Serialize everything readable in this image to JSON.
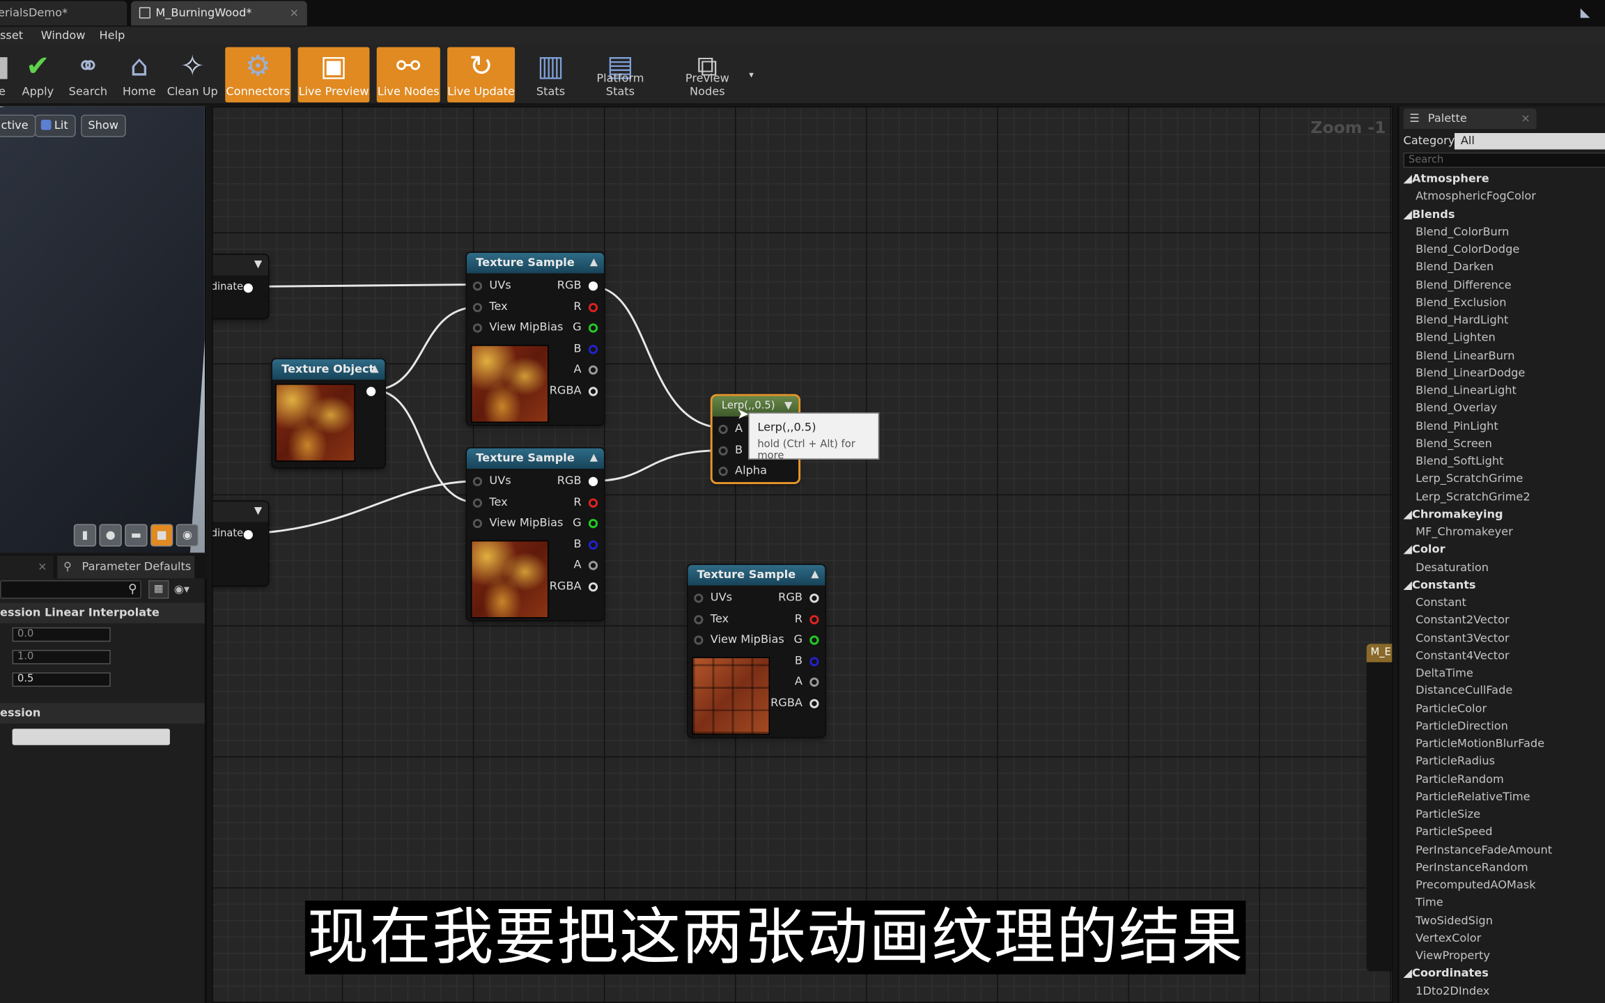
{
  "tabs": [
    {
      "label": "erialsDemo*"
    },
    {
      "label": "M_BurningWood*"
    }
  ],
  "menu": [
    "sset",
    "Window",
    "Help"
  ],
  "toolbar": [
    {
      "label": "e",
      "icon": "save-icon",
      "active": false
    },
    {
      "label": "Apply",
      "icon": "apply-checkmark-icon",
      "active": false
    },
    {
      "label": "Search",
      "icon": "binoculars-icon",
      "active": false
    },
    {
      "label": "Home",
      "icon": "home-icon",
      "active": false
    },
    {
      "label": "Clean Up",
      "icon": "broom-icon",
      "active": false
    },
    {
      "label": "Connectors",
      "icon": "connectors-icon",
      "active": true
    },
    {
      "label": "Live Preview",
      "icon": "live-preview-icon",
      "active": true
    },
    {
      "label": "Live Nodes",
      "icon": "live-nodes-icon",
      "active": true
    },
    {
      "label": "Live Update",
      "icon": "live-update-icon",
      "active": true
    },
    {
      "label": "Stats",
      "icon": "stats-icon",
      "active": false
    },
    {
      "label": "Platform Stats",
      "icon": "platform-stats-icon",
      "active": false
    },
    {
      "label": "Preview Nodes",
      "icon": "preview-nodes-icon",
      "active": false
    }
  ],
  "viewport": {
    "perspective_btn": "ctive",
    "lit_btn": "Lit",
    "show_btn": "Show"
  },
  "details": {
    "tab_params": "Parameter Defaults",
    "section1": "ession Linear Interpolate",
    "fields": [
      "0.0",
      "1.0",
      "0.5"
    ],
    "section2": "ession"
  },
  "graph": {
    "zoom": "Zoom -1",
    "node_partial": "dinate",
    "texture_sample": "Texture Sample",
    "texture_object": "Texture Object",
    "lerp": "Lerp(,,0.5)",
    "pins_in": [
      "UVs",
      "Tex",
      "View MipBias"
    ],
    "pins_out": [
      "RGB",
      "R",
      "G",
      "B",
      "A",
      "RGBA"
    ],
    "lerp_pins": [
      "A",
      "B",
      "Alpha"
    ],
    "tooltip_title": "Lerp(,,0.5)",
    "tooltip_hint": "hold (Ctrl + Alt) for more",
    "right_node": "M_E"
  },
  "palette": {
    "tab": "Palette",
    "category_label": "Category:",
    "category_value": "All",
    "search_placeholder": "Search",
    "groups": [
      {
        "name": "Atmosphere",
        "items": [
          "AtmosphericFogColor"
        ]
      },
      {
        "name": "Blends",
        "items": [
          "Blend_ColorBurn",
          "Blend_ColorDodge",
          "Blend_Darken",
          "Blend_Difference",
          "Blend_Exclusion",
          "Blend_HardLight",
          "Blend_Lighten",
          "Blend_LinearBurn",
          "Blend_LinearDodge",
          "Blend_LinearLight",
          "Blend_Overlay",
          "Blend_PinLight",
          "Blend_Screen",
          "Blend_SoftLight",
          "Lerp_ScratchGrime",
          "Lerp_ScratchGrime2"
        ]
      },
      {
        "name": "Chromakeying",
        "items": [
          "MF_Chromakeyer"
        ]
      },
      {
        "name": "Color",
        "items": [
          "Desaturation"
        ]
      },
      {
        "name": "Constants",
        "items": [
          "Constant",
          "Constant2Vector",
          "Constant3Vector",
          "Constant4Vector",
          "DeltaTime",
          "DistanceCullFade",
          "ParticleColor",
          "ParticleDirection",
          "ParticleMotionBlurFade",
          "ParticleRadius",
          "ParticleRandom",
          "ParticleRelativeTime",
          "ParticleSize",
          "ParticleSpeed",
          "PerInstanceFadeAmount",
          "PerInstanceRandom",
          "PrecomputedAOMask",
          "Time",
          "TwoSidedSign",
          "VertexColor",
          "ViewProperty"
        ]
      },
      {
        "name": "Coordinates",
        "items": [
          "1Dto2DIndex"
        ]
      }
    ]
  },
  "subtitle": "现在我要把这两张动画纹理的结果"
}
